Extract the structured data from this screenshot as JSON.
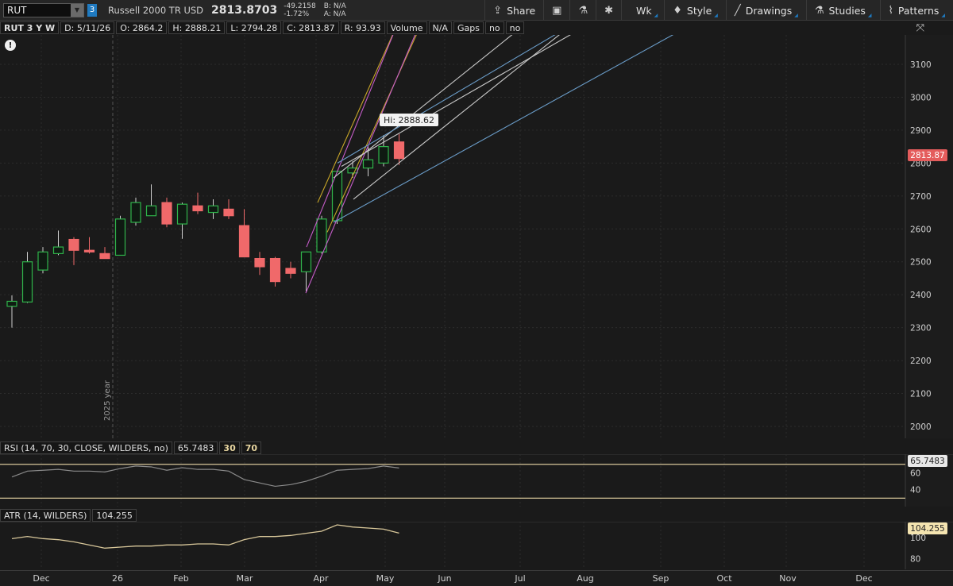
{
  "toolbar": {
    "symbol": "RUT",
    "link_badge": "3",
    "description": "Russell 2000 TR USD",
    "last_price": "2813.8703",
    "net_change": "-49.2158",
    "pct_change": "-1.72%",
    "bid": "B: N/A",
    "ask": "A: N/A",
    "buttons": {
      "share": "Share",
      "aggregation": "Wk",
      "style": "Style",
      "drawings": "Drawings",
      "studies": "Studies",
      "patterns": "Patterns"
    }
  },
  "infobar": {
    "title": "RUT 3 Y W",
    "date": "D: 5/11/26",
    "open": "O: 2864.2",
    "high": "H: 2888.21",
    "low": "L: 2794.28",
    "close": "C: 2813.87",
    "range": "R: 93.93",
    "volume_label": "Volume",
    "volume_value": "N/A",
    "gaps_label": "Gaps",
    "gaps_value1": "no",
    "gaps_value2": "no"
  },
  "alert_icon": "!",
  "year_marker": "2025 year",
  "hi_bubble": "Hi: 2888.62",
  "current_price_tag": "2813.87",
  "colors": {
    "up": "#2fb34a",
    "down": "#f0696a",
    "bg": "#1a1a1a",
    "price_tag": "#e45c5c",
    "rsi_line": "#8a8a8a",
    "rsi_bounds": "#d8c79a",
    "atr_line": "#d8c79a",
    "fib_gold": "#c8a628",
    "fib_magenta": "#c45cc8",
    "fib_gray": "#c9c9c9",
    "fib_blue": "#6a9cc8"
  },
  "chart_data": {
    "type": "candlestick",
    "y_axis_ticks": [
      2000,
      2100,
      2200,
      2300,
      2400,
      2500,
      2600,
      2700,
      2800,
      2900,
      3000,
      3100
    ],
    "x_axis_labels": [
      "Dec",
      "26",
      "Feb",
      "Mar",
      "Apr",
      "May",
      "Jun",
      "Jul",
      "Aug",
      "Sep",
      "Oct",
      "Nov",
      "Dec"
    ],
    "candles": [
      {
        "o": 2365,
        "h": 2398,
        "l": 2300,
        "c": 2380
      },
      {
        "o": 2378,
        "h": 2530,
        "l": 2375,
        "c": 2500
      },
      {
        "o": 2475,
        "h": 2545,
        "l": 2465,
        "c": 2530
      },
      {
        "o": 2525,
        "h": 2595,
        "l": 2520,
        "c": 2545
      },
      {
        "o": 2568,
        "h": 2575,
        "l": 2490,
        "c": 2535
      },
      {
        "o": 2535,
        "h": 2575,
        "l": 2525,
        "c": 2530
      },
      {
        "o": 2525,
        "h": 2545,
        "l": 2510,
        "c": 2510
      },
      {
        "o": 2520,
        "h": 2640,
        "l": 2520,
        "c": 2630
      },
      {
        "o": 2620,
        "h": 2695,
        "l": 2610,
        "c": 2680
      },
      {
        "o": 2640,
        "h": 2735,
        "l": 2640,
        "c": 2670
      },
      {
        "o": 2680,
        "h": 2695,
        "l": 2605,
        "c": 2615
      },
      {
        "o": 2615,
        "h": 2680,
        "l": 2570,
        "c": 2675
      },
      {
        "o": 2670,
        "h": 2710,
        "l": 2645,
        "c": 2655
      },
      {
        "o": 2650,
        "h": 2690,
        "l": 2630,
        "c": 2670
      },
      {
        "o": 2660,
        "h": 2690,
        "l": 2630,
        "c": 2640
      },
      {
        "o": 2610,
        "h": 2660,
        "l": 2550,
        "c": 2515
      },
      {
        "o": 2510,
        "h": 2530,
        "l": 2460,
        "c": 2485
      },
      {
        "o": 2510,
        "h": 2515,
        "l": 2425,
        "c": 2440
      },
      {
        "o": 2480,
        "h": 2500,
        "l": 2450,
        "c": 2465
      },
      {
        "o": 2470,
        "h": 2530,
        "l": 2410,
        "c": 2530
      },
      {
        "o": 2530,
        "h": 2640,
        "l": 2525,
        "c": 2630
      },
      {
        "o": 2625,
        "h": 2775,
        "l": 2615,
        "c": 2775
      },
      {
        "o": 2770,
        "h": 2805,
        "l": 2755,
        "c": 2785
      },
      {
        "o": 2785,
        "h": 2855,
        "l": 2760,
        "c": 2810
      },
      {
        "o": 2800,
        "h": 2885,
        "l": 2790,
        "c": 2850
      },
      {
        "o": 2864.2,
        "h": 2888.21,
        "l": 2794.28,
        "c": 2813.87
      }
    ],
    "high_marker": 2888.62,
    "last_close": 2813.87
  },
  "rsi": {
    "title": "RSI (14, 70, 30, CLOSE, WILDERS, no)",
    "value": "65.7483",
    "lower": "30",
    "upper": "70",
    "y_ticks": [
      40,
      60
    ],
    "values": [
      55,
      62,
      63,
      64,
      62,
      62,
      61,
      65,
      68,
      67,
      63,
      66,
      64,
      64,
      62,
      52,
      48,
      44,
      46,
      50,
      56,
      63,
      64,
      65,
      68,
      65.7
    ]
  },
  "atr": {
    "title": "ATR (14, WILDERS)",
    "value": "104.255",
    "y_ticks": [
      80,
      100
    ],
    "values": [
      99,
      101,
      99,
      98,
      96,
      93,
      90,
      91,
      92,
      92,
      93,
      93,
      94,
      94,
      93,
      98,
      101,
      101,
      102,
      104,
      106,
      112,
      110,
      109,
      108,
      104.255
    ]
  }
}
